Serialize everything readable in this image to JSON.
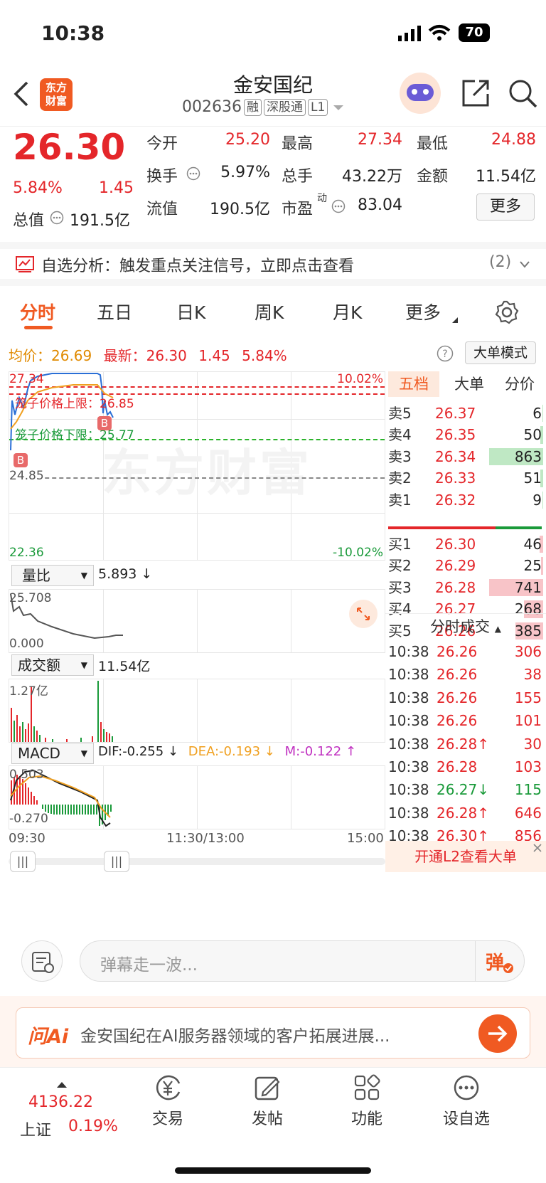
{
  "status_bar": {
    "time": "10:38",
    "battery": "70"
  },
  "header": {
    "logo_line1": "东方",
    "logo_line2": "财富",
    "title": "金安国纪",
    "code": "002636",
    "tags": [
      "融",
      "深股通",
      "L1"
    ]
  },
  "quote": {
    "price": "26.30",
    "pct": "5.84%",
    "change": "1.45",
    "open_label": "今开",
    "open": "25.20",
    "high_label": "最高",
    "high": "27.34",
    "low_label": "最低",
    "low": "24.88",
    "turnover_label": "换手",
    "turnover": "5.97%",
    "volume_label": "总手",
    "volume": "43.22万",
    "amount_label": "金额",
    "amount": "11.54亿",
    "mktcap_label": "总值",
    "mktcap": "191.5亿",
    "float_label": "流值",
    "float": "190.5亿",
    "pe_label": "市盈",
    "pe_sup": "动",
    "pe": "83.04",
    "more": "更多"
  },
  "alert": {
    "text": "自选分析：触发重点关注信号，立即点击查看",
    "count": "(2)"
  },
  "tabs": [
    "分时",
    "五日",
    "日K",
    "周K",
    "月K",
    "更多"
  ],
  "chart_info": {
    "avg_label": "均价：",
    "avg": "26.69",
    "latest_label": "最新：",
    "latest": "26.30",
    "change": "1.45",
    "pct": "5.84%",
    "mode_button": "大单模式"
  },
  "intraday": {
    "top_price": "27.34",
    "top_pct": "10.02%",
    "limit_up": "笼子价格上限：26.85",
    "limit_down": "笼子价格下限：25.77",
    "prev_close": "24.85",
    "bottom_price": "22.36",
    "bottom_pct": "-10.02%",
    "watermark": "东方财富",
    "buy_marker": "B"
  },
  "volume_ratio": {
    "label": "量比",
    "value": "5.893 ↓",
    "max": "25.708",
    "min": "0.000"
  },
  "amount_panel": {
    "label": "成交额",
    "value": "11.54亿",
    "max": "1.27亿"
  },
  "macd": {
    "label": "MACD",
    "dif": "DIF:-0.255 ↓",
    "dea": "DEA:-0.193 ↓",
    "m": "M:-0.122 ↑",
    "max": "0.503",
    "min": "-0.270"
  },
  "time_axis": [
    "09:30",
    "11:30/13:00",
    "15:00"
  ],
  "orderbook_tabs": [
    "五档",
    "大单",
    "分价"
  ],
  "asks": [
    {
      "label": "卖5",
      "price": "26.37",
      "vol": "6"
    },
    {
      "label": "卖4",
      "price": "26.35",
      "vol": "50"
    },
    {
      "label": "卖3",
      "price": "26.34",
      "vol": "863"
    },
    {
      "label": "卖2",
      "price": "26.33",
      "vol": "51"
    },
    {
      "label": "卖1",
      "price": "26.32",
      "vol": "9"
    }
  ],
  "bids": [
    {
      "label": "买1",
      "price": "26.30",
      "vol": "46"
    },
    {
      "label": "买2",
      "price": "26.29",
      "vol": "25"
    },
    {
      "label": "买3",
      "price": "26.28",
      "vol": "741"
    },
    {
      "label": "买4",
      "price": "26.27",
      "vol": "268"
    },
    {
      "label": "买5",
      "price": "26.26",
      "vol": "385"
    }
  ],
  "ticks_title": "分时成交",
  "ticks": [
    {
      "time": "10:38",
      "price": "26.26",
      "vol": "306"
    },
    {
      "time": "10:38",
      "price": "26.26",
      "vol": "38"
    },
    {
      "time": "10:38",
      "price": "26.26",
      "vol": "155"
    },
    {
      "time": "10:38",
      "price": "26.26",
      "vol": "101"
    },
    {
      "time": "10:38",
      "price": "26.28↑",
      "vol": "30"
    },
    {
      "time": "10:38",
      "price": "26.28",
      "vol": "103"
    },
    {
      "time": "10:38",
      "price": "26.27↓",
      "vol": "115"
    },
    {
      "time": "10:38",
      "price": "26.28↑",
      "vol": "646"
    },
    {
      "time": "10:38",
      "price": "26.30↑",
      "vol": "856"
    }
  ],
  "l2_banner": "开通L2查看大单",
  "danmu": {
    "placeholder": "弹幕走一波...",
    "button": "弹"
  },
  "ask_ai": {
    "brand": "问Ai",
    "text": "金安国纪在AI服务器领域的客户拓展进展..."
  },
  "bottom_bar": {
    "index_value": "4136.22",
    "index_name": "上证",
    "index_pct": "0.19%",
    "items": [
      "交易",
      "发帖",
      "功能",
      "设自选"
    ]
  },
  "colors": {
    "up": "#e4262a",
    "down": "#1a9a3a",
    "brand": "#f05a22"
  }
}
